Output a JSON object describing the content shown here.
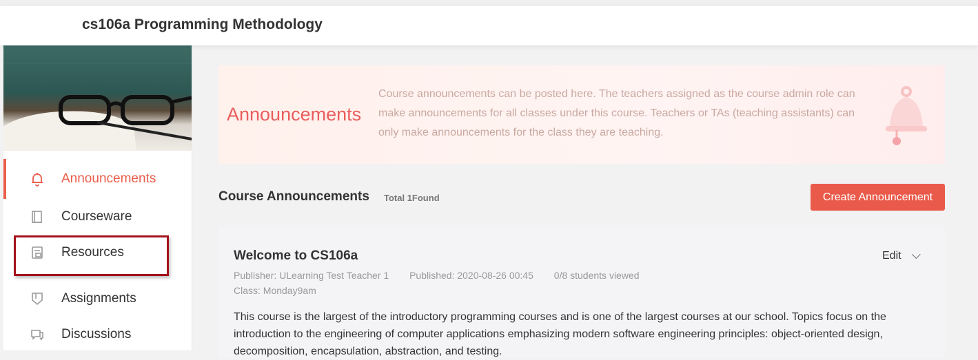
{
  "header": {
    "course_title": "cs106a Programming Methodology"
  },
  "sidebar": {
    "items": [
      {
        "label": "Announcements",
        "icon": "bell-icon",
        "active": true
      },
      {
        "label": "Courseware",
        "icon": "book-icon",
        "active": false
      },
      {
        "label": "Resources",
        "icon": "resources-icon",
        "active": false
      },
      {
        "label": "Assignments",
        "icon": "shield-icon",
        "active": false
      },
      {
        "label": "Discussions",
        "icon": "chat-icon",
        "active": false
      }
    ]
  },
  "banner": {
    "title": "Announcements",
    "description": "Course announcements can be posted here. The teachers assigned as the course admin role can make announcements for all classes under this course. Teachers or TAs (teaching assistants) can only make announcements for the class they are teaching."
  },
  "section": {
    "title": "Course Announcements",
    "total": "Total 1Found",
    "create_label": "Create Announcement"
  },
  "announcement": {
    "title": "Welcome to CS106a",
    "edit_label": "Edit",
    "publisher": "Publisher: ULearning Test Teacher 1",
    "published": "Published: 2020-08-26 00:45",
    "viewed": "0/8 students viewed",
    "class": "Class: Monday9am",
    "body": "This course is the largest of the introductory programming courses and is one of the largest courses at our school. Topics focus on the introduction to the engineering of computer applications emphasizing modern software engineering principles: object-oriented design, decomposition, encapsulation, abstraction, and testing."
  },
  "colors": {
    "accent": "#ea5a4a",
    "highlight_box": "#a3131b"
  }
}
